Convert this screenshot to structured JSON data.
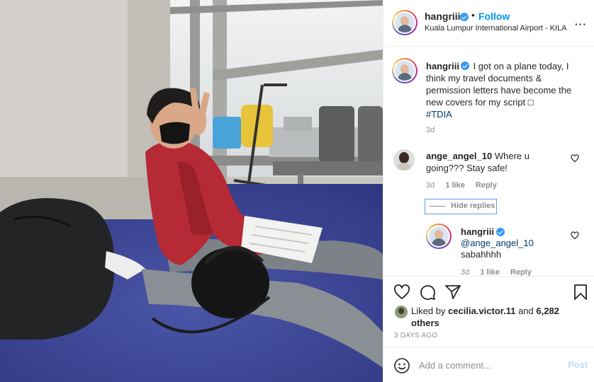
{
  "header": {
    "username": "hangriii",
    "dot": "•",
    "follow_label": "Follow",
    "location": "Kuala Lumpur International Airport - KILA",
    "more_label": "···",
    "more_icon": "more-dots-icon"
  },
  "caption": {
    "username": "hangriii",
    "text": "I got on a plane today, I think my travel documents & permission letters have become the new covers for my script □",
    "hashtag": "#TDIA",
    "time": "3d"
  },
  "comment": {
    "username": "ange_angel_10",
    "text": "Where u going??? Stay safe!",
    "time": "3d",
    "likes": "1 like",
    "reply_label": "Reply",
    "hide_replies_label": "Hide replies"
  },
  "reply": {
    "username": "hangriii",
    "mention": "@ange_angel_10",
    "text": "sabahhhh",
    "time": "3d",
    "likes": "1 like",
    "reply_label": "Reply"
  },
  "actions": {
    "icons": [
      "heart-icon",
      "comment-icon",
      "share-icon",
      "bookmark-icon"
    ],
    "liked_by_prefix": "Liked by",
    "liked_by_user": "cecilia.victor.11",
    "liked_by_and": "and",
    "others": "6,282 others",
    "post_time": "3 DAYS AGO"
  },
  "add_comment": {
    "placeholder": "Add a comment...",
    "post_label": "Post"
  },
  "colors": {
    "accent": "#0095f6",
    "post_disabled": "#b2dffc",
    "hashtag": "#00376b",
    "jacket": "#b52a35"
  }
}
